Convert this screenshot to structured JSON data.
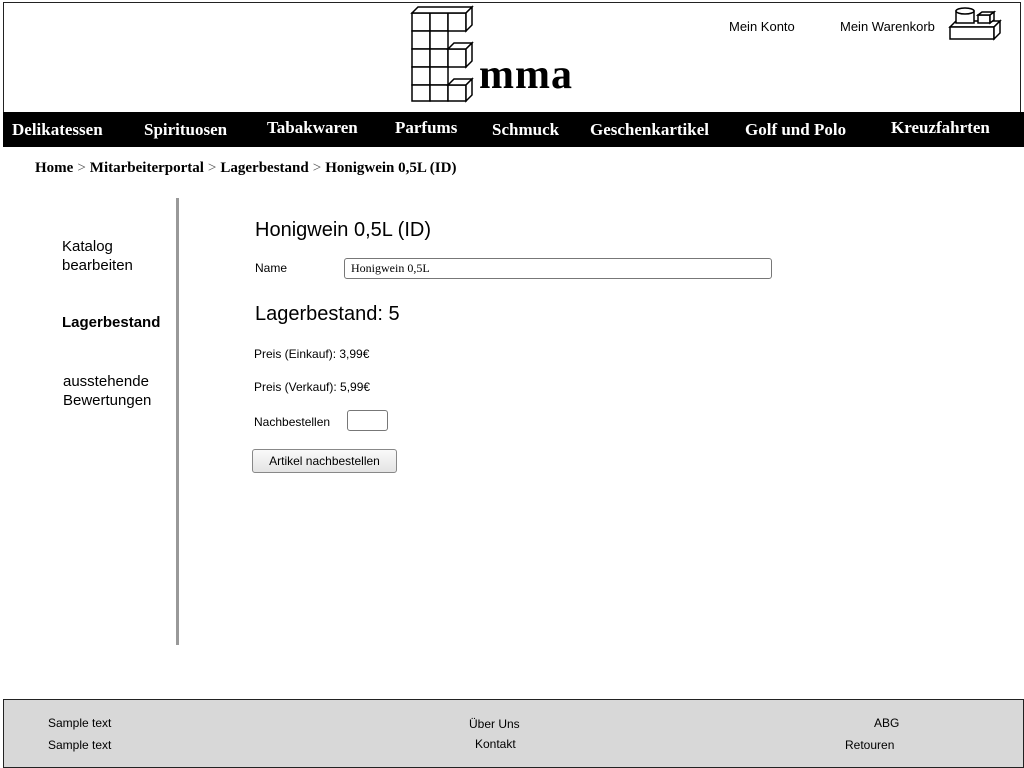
{
  "header": {
    "brand": "mma",
    "account_label": "Mein Konto",
    "cart_label": "Mein Warenkorb",
    "cart_icon": "cart-icon",
    "logo_icon": "e-blocks-logo"
  },
  "nav": {
    "items": [
      "Delikatessen",
      "Spirituosen",
      "Tabakwaren",
      "Parfums",
      "Schmuck",
      "Geschenkartikel",
      "Golf und Polo",
      "Kreuzfahrten"
    ]
  },
  "breadcrumb": {
    "items": [
      "Home",
      "Mitarbeiterportal",
      "Lagerbestand",
      "Honigwein 0,5L (ID)"
    ],
    "separator": ">"
  },
  "sidebar": {
    "items": [
      {
        "line1": "Katalog",
        "line2": "bearbeiten"
      },
      {
        "line1": "Lagerbestand",
        "line2": ""
      },
      {
        "line1": "ausstehende",
        "line2": "Bewertungen"
      }
    ]
  },
  "main": {
    "title": "Honigwein 0,5L (ID)",
    "name_label": "Name",
    "name_value": "Honigwein 0,5L",
    "stock_title": "Lagerbestand: 5",
    "price_buy": "Preis (Einkauf): 3,99€",
    "price_sell": "Preis (Verkauf): 5,99€",
    "reorder_label": "Nachbestellen",
    "reorder_value": "",
    "reorder_button": "Artikel nachbestellen"
  },
  "footer": {
    "col1": [
      "Sample text",
      "Sample text"
    ],
    "col2": [
      "Über Uns",
      "Kontakt"
    ],
    "col3": [
      "ABG",
      "Retouren"
    ]
  },
  "colors": {
    "nav_background": "#000000",
    "footer_background": "#d8d8d8",
    "divider": "#999999"
  }
}
